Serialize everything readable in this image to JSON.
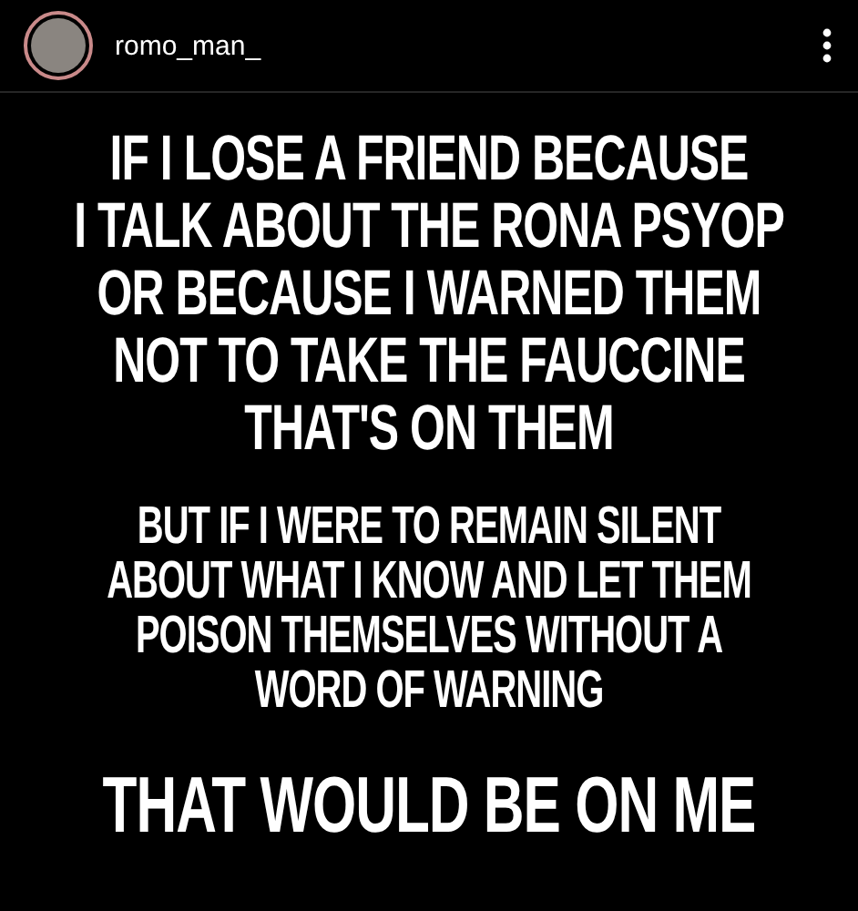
{
  "post": {
    "username": "romo_man_"
  },
  "meme": {
    "blocks": [
      {
        "kind": "lead",
        "lines": [
          "IF I LOSE A FRIEND BECAUSE",
          "I TALK ABOUT THE RONA PSYOP",
          "OR BECAUSE I WARNED THEM",
          "NOT TO TAKE THE FAUCCINE",
          "THAT'S ON THEM"
        ]
      },
      {
        "kind": "body",
        "lines": [
          "BUT IF I WERE TO REMAIN SILENT",
          "ABOUT WHAT I KNOW AND LET THEM",
          "POISON THEMSELVES WITHOUT A",
          "WORD OF WARNING"
        ]
      },
      {
        "kind": "punchline",
        "lines": [
          "THAT WOULD BE ON ME"
        ]
      }
    ]
  }
}
